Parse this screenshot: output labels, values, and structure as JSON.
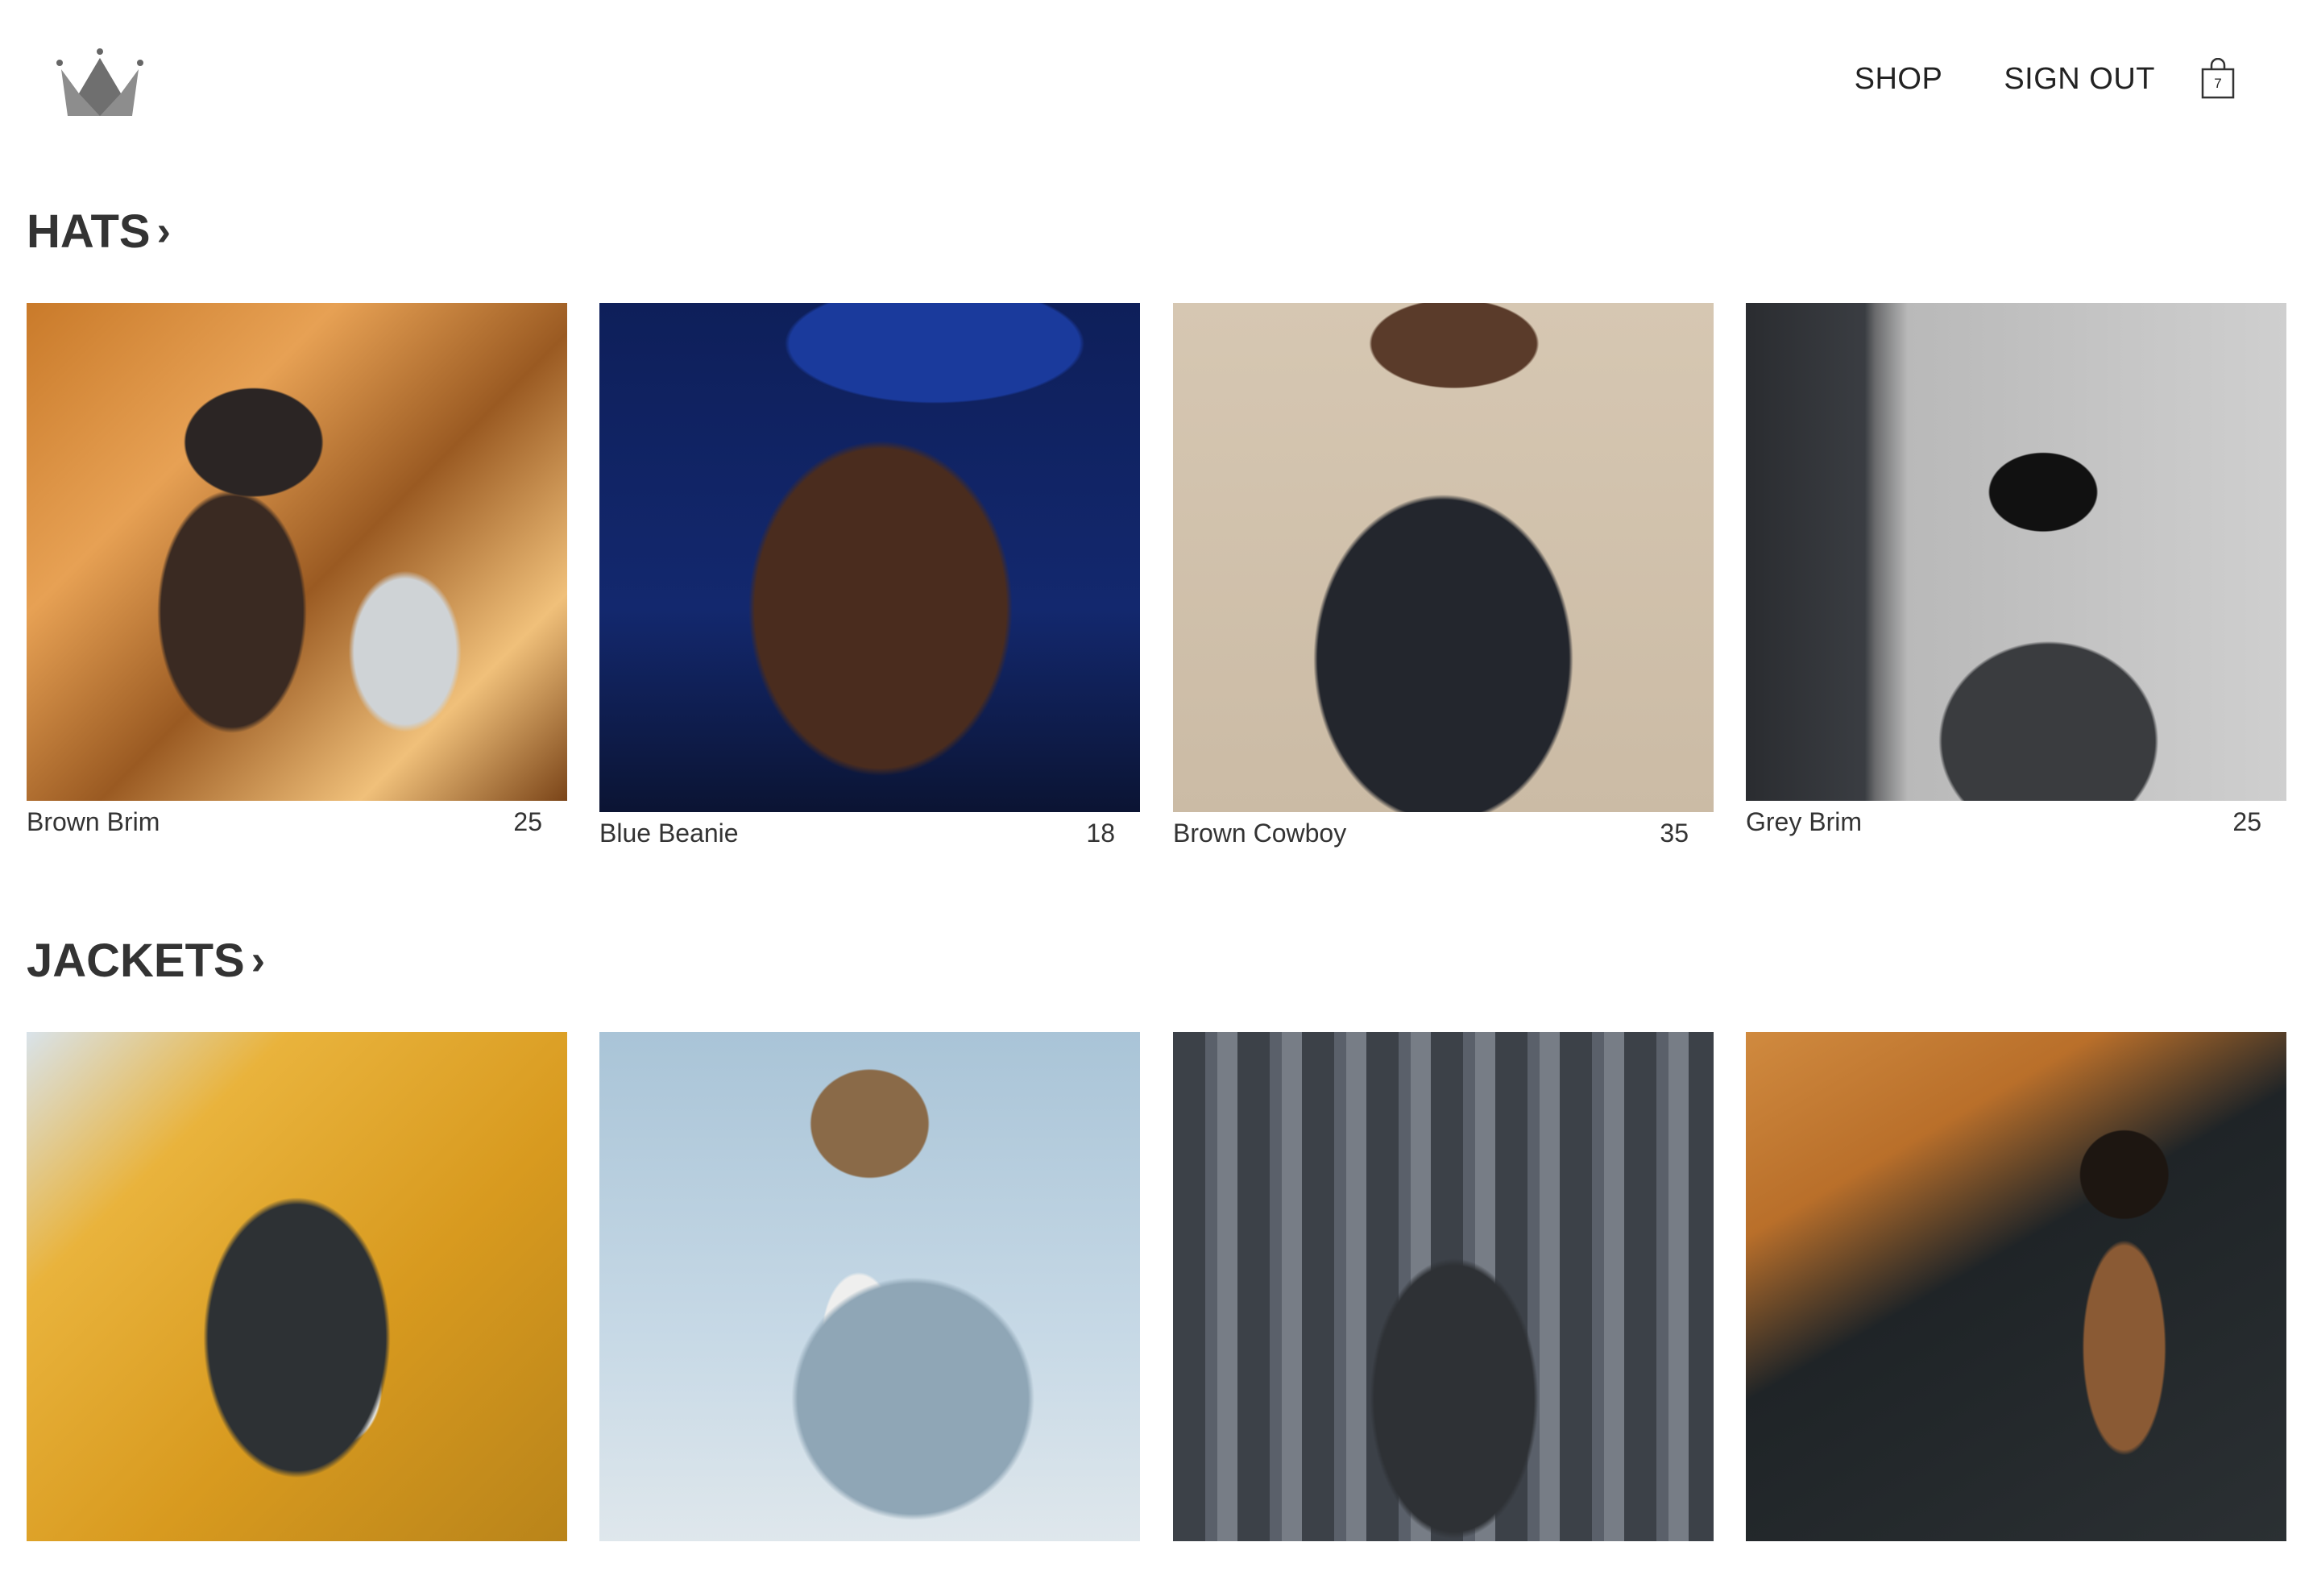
{
  "header": {
    "logo_icon": "crown-icon",
    "nav": {
      "shop": "SHOP",
      "sign_out": "SIGN OUT"
    },
    "cart": {
      "icon": "shopping-bag-icon",
      "count": "7"
    }
  },
  "sections": [
    {
      "title": "HATS",
      "items": [
        {
          "name": "Brown Brim",
          "price": "25"
        },
        {
          "name": "Blue Beanie",
          "price": "18"
        },
        {
          "name": "Brown Cowboy",
          "price": "35"
        },
        {
          "name": "Grey Brim",
          "price": "25"
        }
      ]
    },
    {
      "title": "JACKETS",
      "items": [
        {
          "name": "",
          "price": ""
        },
        {
          "name": "",
          "price": ""
        },
        {
          "name": "",
          "price": ""
        },
        {
          "name": "",
          "price": ""
        }
      ]
    }
  ]
}
